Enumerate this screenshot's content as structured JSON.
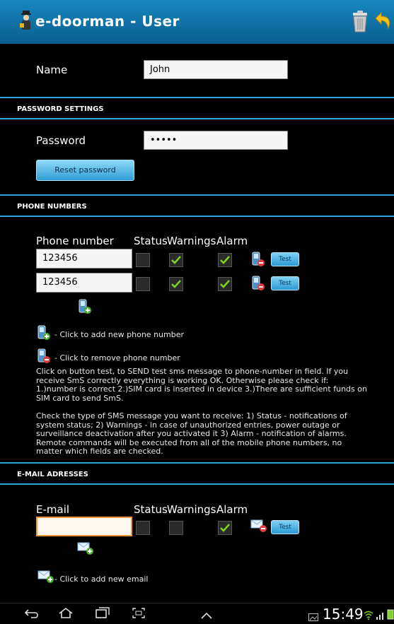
{
  "header": {
    "title": "e-doorman - User",
    "delete_icon": "trash-icon",
    "back_icon": "back-arrow-icon",
    "logo_icon": "doorman-icon"
  },
  "name_row": {
    "label": "Name",
    "value": "John"
  },
  "password_section": {
    "title": "PASSWORD SETTINGS",
    "label": "Password",
    "value": "•••••",
    "reset_label": "Reset password"
  },
  "phone_section": {
    "title": "PHONE NUMBERS",
    "headers": {
      "number": "Phone number",
      "status": "Status",
      "warnings": "Warnings",
      "alarm": "Alarm"
    },
    "rows": [
      {
        "number": "123456",
        "status": false,
        "warnings": true,
        "alarm": true,
        "test": "Test"
      },
      {
        "number": "123456",
        "status": false,
        "warnings": true,
        "alarm": true,
        "test": "Test"
      }
    ],
    "legend_add": "- Click to add new phone number",
    "legend_remove": "- Click to remove phone number",
    "note1": "Click on button test, to SEND test sms message to phone-number in field. If you receive SmS correctly everything is working OK. Otherwise please check if: 1.)number is correct 2.)SIM card is inserted in device 3.)There are sufficient funds on SIM card to send SmS.",
    "note2": "Check the type of SMS message you want to receive: 1) Status - notifications of system status; 2) Warnings - in case of unauthorized entries, power outage or surveillance deactivation after you activated it 3) Alarm - notification of alarms. Remote commands will be executed from all of the mobile phone numbers, no matter which fields are checked."
  },
  "email_section": {
    "title": "E-MAIL ADRESSES",
    "headers": {
      "email": "E-mail",
      "status": "Status",
      "warnings": "Warnings",
      "alarm": "Alarm"
    },
    "rows": [
      {
        "email": "",
        "status": false,
        "warnings": false,
        "alarm": true,
        "test": "Test"
      }
    ],
    "legend_add": "- Click to add new email"
  },
  "statusbar": {
    "time": "15:49"
  },
  "colors": {
    "accent": "#2aa4dc",
    "titlebar": "#1282b8",
    "check": "#7ed321",
    "email_focus": "#f29a3b"
  }
}
